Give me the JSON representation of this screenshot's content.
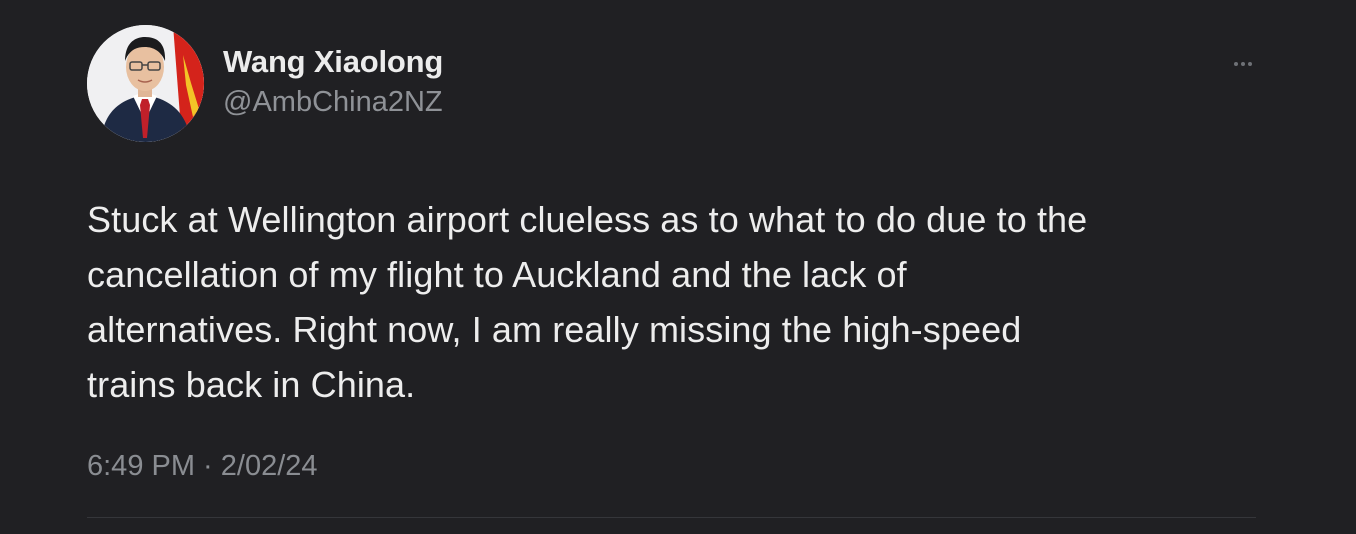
{
  "tweet": {
    "author": {
      "name": "Wang Xiaolong",
      "handle": "@AmbChina2NZ",
      "avatar": "profile-photo"
    },
    "more_icon": "more-options-icon",
    "text_lines": [
      "Stuck at Wellington airport clueless as to what to do due to the",
      "cancellation of my flight to Auckland and the lack of",
      "alternatives. Right now, I am really missing the high-speed",
      "trains back in China."
    ],
    "timestamp": "6:49 PM · 2/02/24",
    "colors": {
      "background": "#202023",
      "text": "#ededed",
      "muted": "#8f9297"
    }
  }
}
